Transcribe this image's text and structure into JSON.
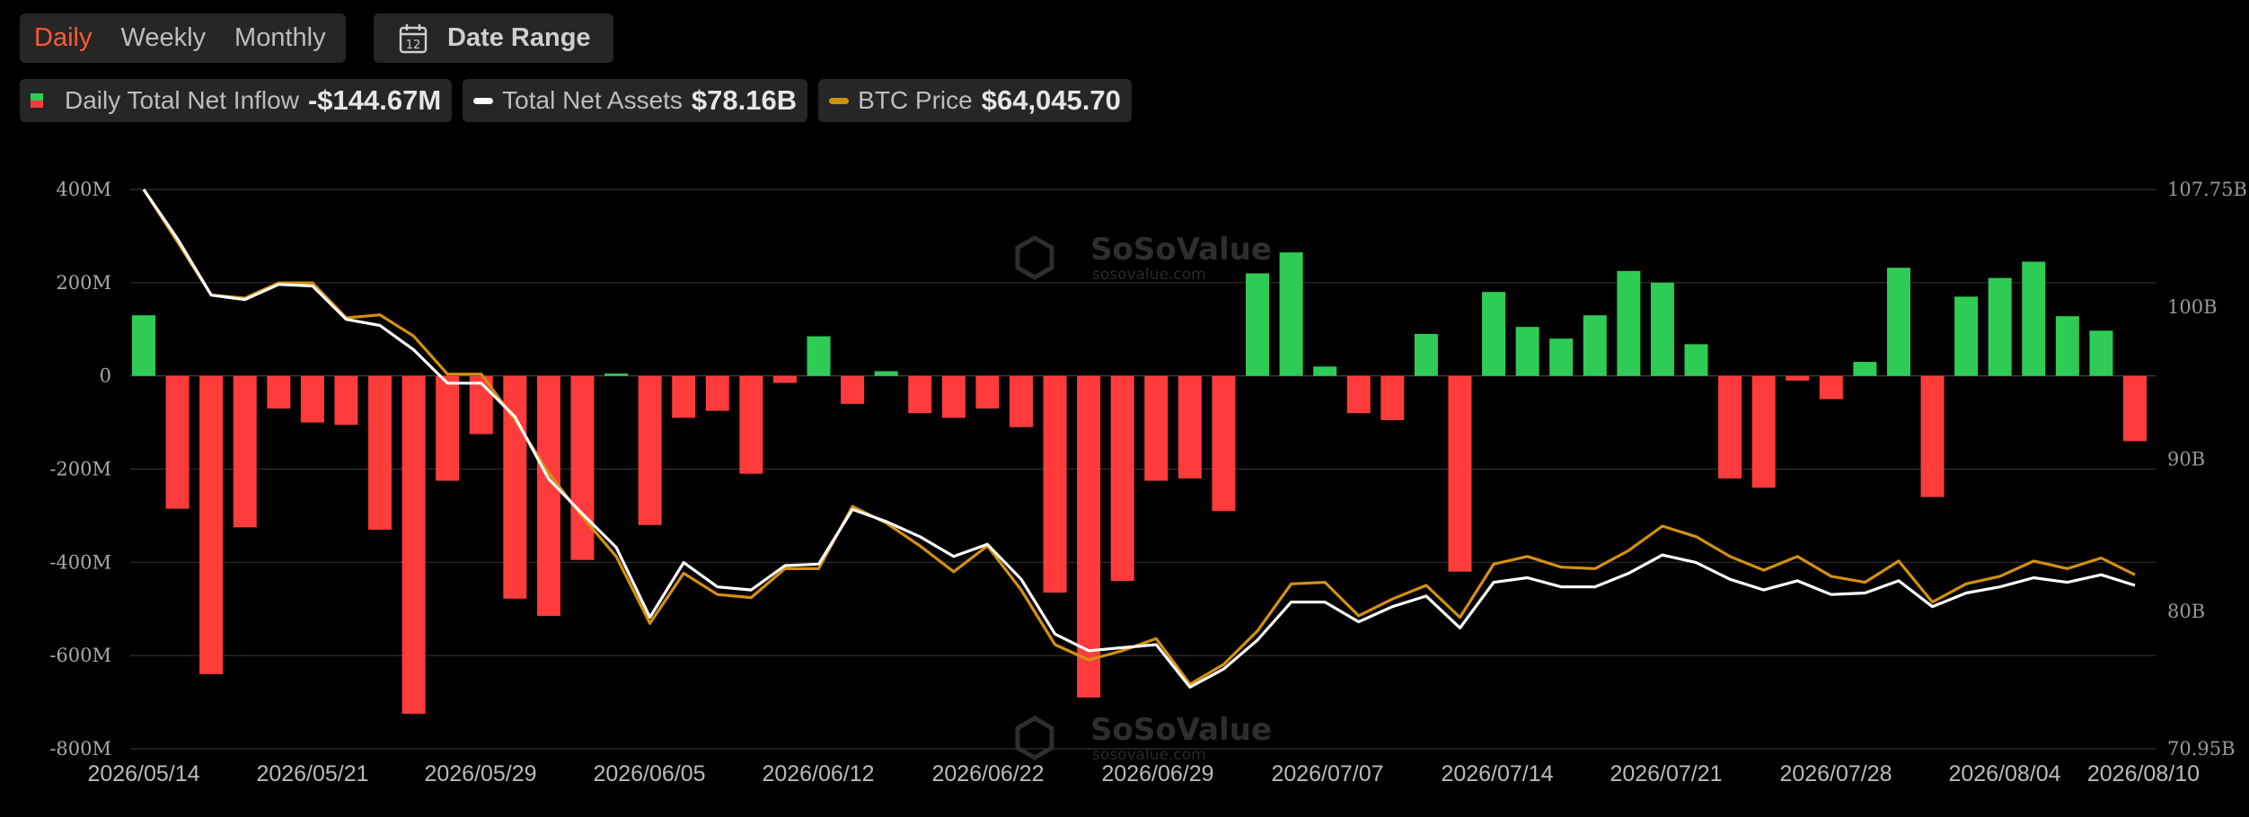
{
  "periods": [
    "Daily",
    "Weekly",
    "Monthly"
  ],
  "active_period": "Daily",
  "date_range": {
    "label": "Date Range",
    "icon_day": "12"
  },
  "legend": {
    "inflow": {
      "label": "Daily Total Net Inflow",
      "value": "-$144.67M",
      "color_pos": "#2ecc55",
      "color_neg": "#ff3b3b"
    },
    "assets": {
      "label": "Total Net Assets",
      "value": "$78.16B",
      "color": "#ffffff"
    },
    "btc": {
      "label": "BTC Price",
      "value": "$64,045.70",
      "color": "#d4900e"
    }
  },
  "watermark": {
    "name": "SoSoValue",
    "site": "sosovalue.com"
  },
  "chart_data": {
    "type": "bar",
    "x_tick_labels": [
      "2026/05/14",
      "2026/05/21",
      "2026/05/29",
      "2026/06/05",
      "2026/06/12",
      "2026/06/22",
      "2026/06/29",
      "2026/07/07",
      "2026/07/14",
      "2026/07/21",
      "2026/07/28",
      "2026/08/04",
      "2026/08/10"
    ],
    "left_axis": {
      "ticks": [
        400,
        200,
        0,
        -200,
        -400,
        -600,
        -800
      ],
      "tick_labels": [
        "400M",
        "200M",
        "0",
        "-200M",
        "-400M",
        "-600M",
        "-800M"
      ],
      "range": [
        -800,
        400
      ]
    },
    "right_axis": {
      "tick_labels": [
        "107.75B",
        "100B",
        "90B",
        "80B",
        "70.95B"
      ],
      "tick_values": [
        107.75,
        100,
        90,
        80,
        70.95
      ],
      "range": [
        70.95,
        107.75
      ]
    },
    "grid": true,
    "series": [
      {
        "name": "Daily Total Net Inflow",
        "type": "bar",
        "unit": "M",
        "values": [
          130,
          -285,
          -640,
          -325,
          -70,
          -100,
          -105,
          -330,
          -725,
          -225,
          -125,
          -478,
          -515,
          -395,
          5,
          -320,
          -90,
          -75,
          -210,
          -15,
          85,
          -60,
          10,
          -80,
          -90,
          -70,
          -110,
          -465,
          -690,
          -440,
          -225,
          -220,
          -290,
          220,
          265,
          20,
          -80,
          -95,
          90,
          -420,
          180,
          105,
          80,
          130,
          225,
          200,
          68,
          -220,
          -240,
          -10,
          -50,
          30,
          232,
          -260,
          170,
          210,
          245,
          128,
          97,
          -140
        ]
      },
      {
        "name": "Total Net Assets",
        "type": "line",
        "unit": "B",
        "values": [
          107.75,
          104.5,
          100.8,
          100.5,
          101.5,
          101.4,
          99.2,
          98.8,
          97.2,
          95,
          95,
          92.8,
          88.7,
          86.4,
          84.2,
          79.6,
          83.2,
          81.6,
          81.4,
          83,
          83.1,
          86.7,
          85.9,
          84.9,
          83.6,
          84.4,
          82.1,
          78.5,
          77.4,
          77.6,
          77.8,
          75,
          76.2,
          78.1,
          80.6,
          80.6,
          79.3,
          80.3,
          81,
          78.9,
          81.9,
          82.2,
          81.6,
          81.6,
          82.5,
          83.7,
          83.2,
          82.1,
          81.4,
          82,
          81.1,
          81.2,
          82,
          80.3,
          81.2,
          81.6,
          82.2,
          81.9,
          82.4,
          81.7
        ]
      },
      {
        "name": "BTC Price",
        "type": "line",
        "unit": "B",
        "values": [
          107.75,
          104.3,
          100.8,
          100.6,
          101.6,
          101.6,
          99.3,
          99.5,
          98.1,
          95.6,
          95.6,
          92.6,
          89.1,
          86.2,
          83.6,
          79.2,
          82.5,
          81.1,
          80.9,
          82.8,
          82.8,
          86.9,
          85.8,
          84.3,
          82.6,
          84.3,
          81.4,
          77.8,
          76.8,
          77.4,
          78.2,
          75.2,
          76.5,
          78.7,
          81.8,
          81.9,
          79.7,
          80.8,
          81.7,
          79.6,
          83.1,
          83.6,
          82.9,
          82.8,
          84,
          85.6,
          84.9,
          83.6,
          82.7,
          83.6,
          82.3,
          81.9,
          83.3,
          80.6,
          81.8,
          82.3,
          83.3,
          82.8,
          83.5,
          82.4
        ]
      }
    ]
  }
}
